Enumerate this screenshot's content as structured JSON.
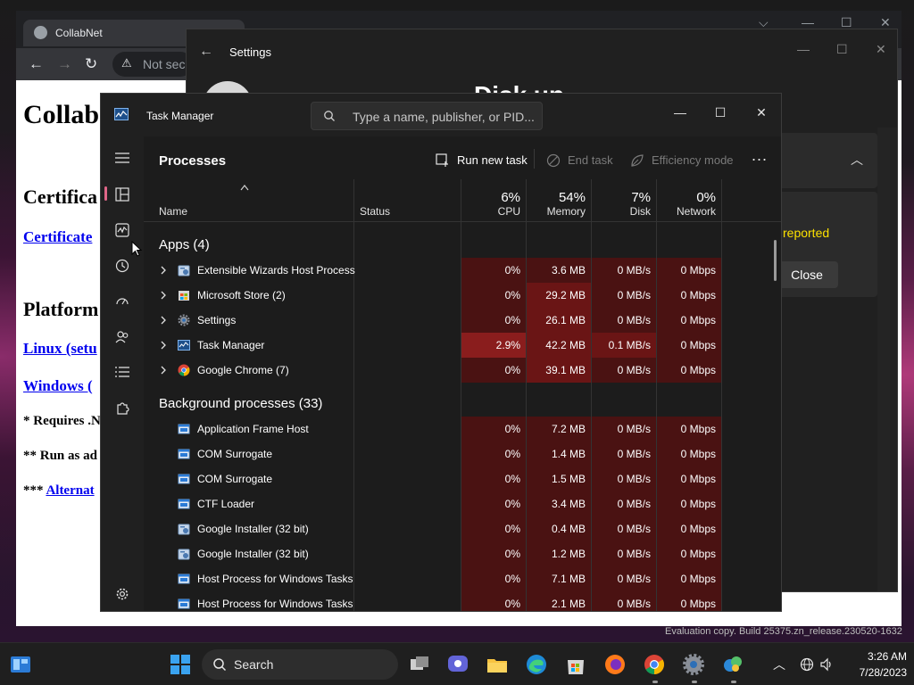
{
  "browser": {
    "tab_title": "CollabNet",
    "omnibox_text": "Not sec",
    "page": {
      "heading": "Collab",
      "section1": "Certifica",
      "link1": "Certificate",
      "section2": "Platform",
      "link2": "Linux (setu",
      "link3": "Windows (",
      "note1": "* Requires .N",
      "note2": "** Run as ad",
      "note3_prefix": "*** ",
      "note3_link": "Alternat"
    }
  },
  "settings": {
    "title": "Settings",
    "heading": "Disk up",
    "reported": "reported",
    "close_label": "Close"
  },
  "task_manager": {
    "title": "Task Manager",
    "search_placeholder": "Type a name, publisher, or PID...",
    "page_title": "Processes",
    "commands": {
      "run_new_task": "Run new task",
      "end_task": "End task",
      "efficiency_mode": "Efficiency mode",
      "more": "..."
    },
    "columns": {
      "name": "Name",
      "status": "Status",
      "cpu": {
        "label": "CPU",
        "total": "6%"
      },
      "memory": {
        "label": "Memory",
        "total": "54%"
      },
      "disk": {
        "label": "Disk",
        "total": "7%"
      },
      "network": {
        "label": "Network",
        "total": "0%"
      }
    },
    "apps_group": "Apps (4)",
    "apps": [
      {
        "name": "Extensible Wizards Host Process",
        "cpu": "0%",
        "memory": "3.6 MB",
        "disk": "0 MB/s",
        "network": "0 Mbps",
        "icon": "wizard-icon"
      },
      {
        "name": "Microsoft Store (2)",
        "cpu": "0%",
        "memory": "29.2 MB",
        "disk": "0 MB/s",
        "network": "0 Mbps",
        "icon": "store-icon"
      },
      {
        "name": "Settings",
        "cpu": "0%",
        "memory": "26.1 MB",
        "disk": "0 MB/s",
        "network": "0 Mbps",
        "icon": "gear-icon"
      },
      {
        "name": "Task Manager",
        "cpu": "2.9%",
        "memory": "42.2 MB",
        "disk": "0.1 MB/s",
        "network": "0 Mbps",
        "icon": "task-manager-icon"
      },
      {
        "name": "Google Chrome (7)",
        "cpu": "0%",
        "memory": "39.1 MB",
        "disk": "0 MB/s",
        "network": "0 Mbps",
        "icon": "chrome-icon"
      }
    ],
    "background_group": "Background processes (33)",
    "background": [
      {
        "name": "Application Frame Host",
        "cpu": "0%",
        "memory": "7.2 MB",
        "disk": "0 MB/s",
        "network": "0 Mbps",
        "icon": "window-icon"
      },
      {
        "name": "COM Surrogate",
        "cpu": "0%",
        "memory": "1.4 MB",
        "disk": "0 MB/s",
        "network": "0 Mbps",
        "icon": "window-icon"
      },
      {
        "name": "COM Surrogate",
        "cpu": "0%",
        "memory": "1.5 MB",
        "disk": "0 MB/s",
        "network": "0 Mbps",
        "icon": "window-icon"
      },
      {
        "name": "CTF Loader",
        "cpu": "0%",
        "memory": "3.4 MB",
        "disk": "0 MB/s",
        "network": "0 Mbps",
        "icon": "window-icon"
      },
      {
        "name": "Google Installer (32 bit)",
        "cpu": "0%",
        "memory": "0.4 MB",
        "disk": "0 MB/s",
        "network": "0 Mbps",
        "icon": "installer-icon"
      },
      {
        "name": "Google Installer (32 bit)",
        "cpu": "0%",
        "memory": "1.2 MB",
        "disk": "0 MB/s",
        "network": "0 Mbps",
        "icon": "installer-icon"
      },
      {
        "name": "Host Process for Windows Tasks",
        "cpu": "0%",
        "memory": "7.1 MB",
        "disk": "0 MB/s",
        "network": "0 Mbps",
        "icon": "window-icon"
      },
      {
        "name": "Host Process for Windows Tasks",
        "cpu": "0%",
        "memory": "2.1 MB",
        "disk": "0 MB/s",
        "network": "0 Mbps",
        "icon": "window-icon"
      }
    ]
  },
  "taskbar": {
    "search_label": "Search",
    "time": "3:26 AM",
    "date": "7/28/2023",
    "watermark": "Evaluation copy. Build 25375.zn_release.230520-1632"
  },
  "colors": {
    "accent": "#e06688",
    "heat_low": "#4a1212",
    "heat_mid": "#6a1515",
    "heat_high": "#8a1d1d",
    "link": "#0000ee"
  }
}
